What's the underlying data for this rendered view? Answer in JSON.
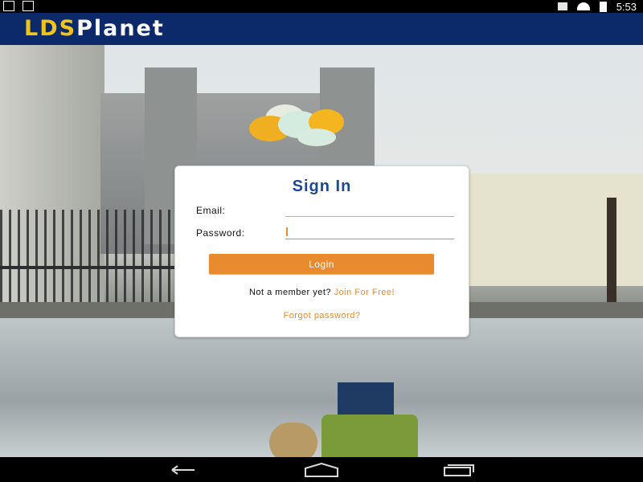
{
  "status_bar": {
    "time": "5:53"
  },
  "app_bar": {
    "logo_part1": "LDS",
    "logo_part2": "Planet",
    "logo_color_primary": "#f0c419",
    "background": "#0c2a6a"
  },
  "sign_in": {
    "title": "Sign In",
    "email_label": "Email:",
    "email_value": "",
    "password_label": "Password:",
    "password_value": "",
    "login_button": "Login",
    "member_prompt": "Not a member yet?",
    "join_link": "Join For Free!",
    "forgot_link": "Forgot password?",
    "accent_color": "#e88a2e",
    "title_color": "#1b4a91"
  },
  "nav_bar": {
    "icons": [
      "back-icon",
      "home-icon",
      "recent-apps-icon"
    ]
  }
}
